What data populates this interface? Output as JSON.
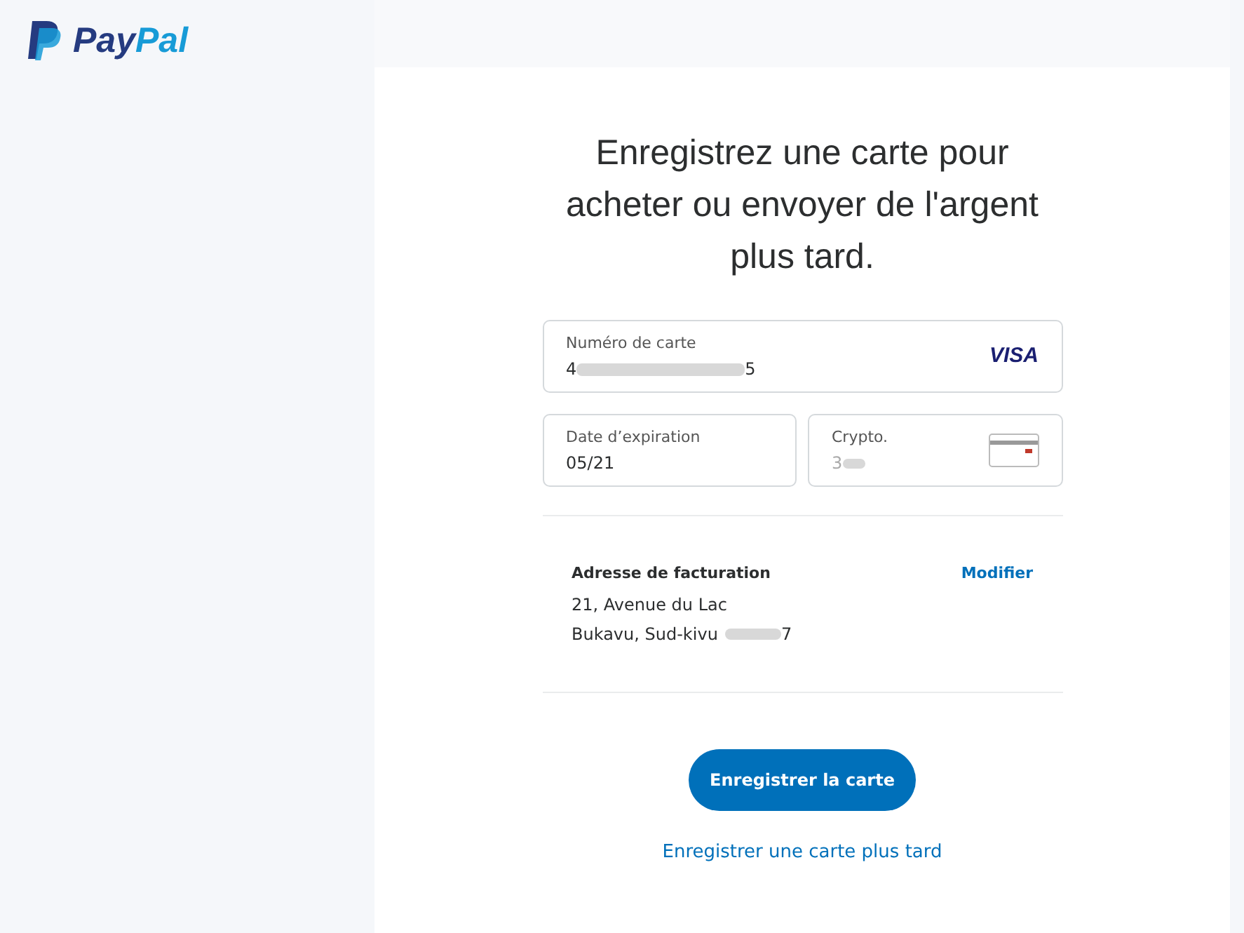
{
  "logo": {
    "part_1": "Pay",
    "part_2": "Pal"
  },
  "heading": "Enregistrez une carte pour acheter ou envoyer de l'argent plus tard.",
  "card_number": {
    "label": "Numéro de carte",
    "value_start": "4",
    "value_end": "5",
    "redacted": true,
    "brand": "VISA"
  },
  "expiry": {
    "label": "Date d’expiration",
    "value": "05/21"
  },
  "cvv": {
    "label": "Crypto.",
    "value_start": "3",
    "redacted": true
  },
  "billing": {
    "title": "Adresse de facturation",
    "edit_link": "Modifier",
    "line_1": "21, Avenue du Lac",
    "line_2_start": "Bukavu, Sud-kivu",
    "line_2_end": "7",
    "redacted": true
  },
  "submit_button": "Enregistrer la carte",
  "later_link": "Enregistrer une carte plus tard"
}
